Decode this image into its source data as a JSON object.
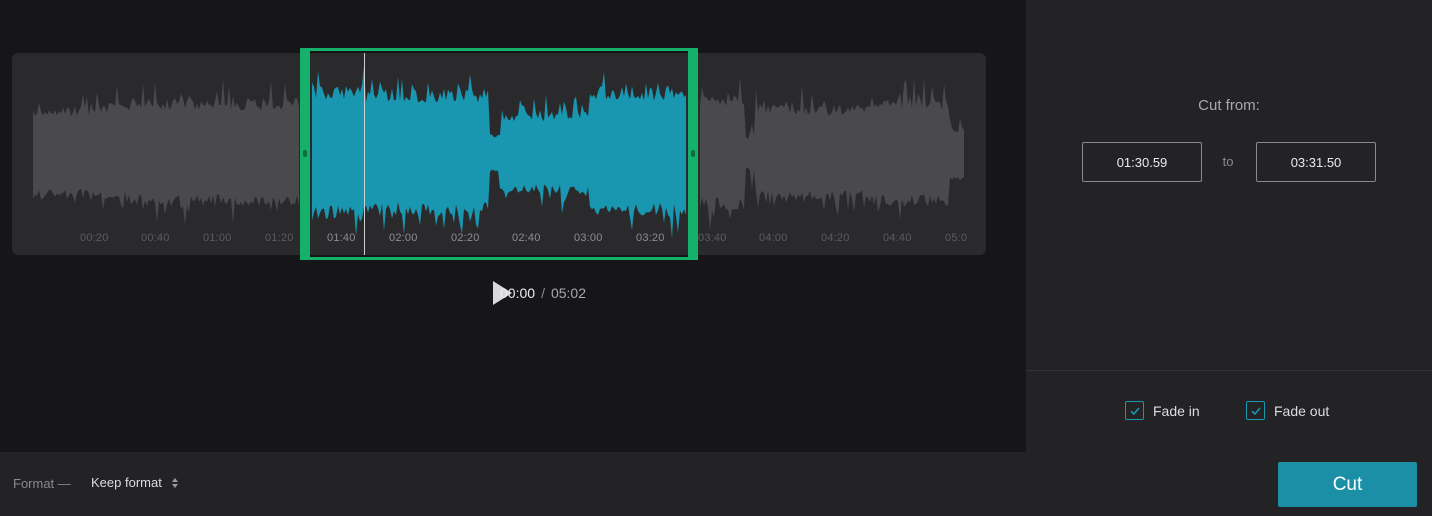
{
  "editor": {
    "ticks": [
      "00:20",
      "00:40",
      "01:00",
      "01:20",
      "01:40",
      "02:00",
      "02:20",
      "02:40",
      "03:00",
      "03:20",
      "03:40",
      "04:00",
      "04:20",
      "04:40",
      "05:0"
    ],
    "play_icon": "play-icon",
    "time": {
      "current": "00:00",
      "separator": "/",
      "total": "05:02"
    },
    "colors": {
      "selected_wave": "#1a97b0",
      "unselected_wave": "#4a4a4c",
      "selection_frame": "#15b06a"
    }
  },
  "panel": {
    "cut_from_label": "Cut from:",
    "start_value": "01:30.59",
    "to_label": "to",
    "end_value": "03:31.50",
    "fade_in": {
      "label": "Fade in",
      "checked": true
    },
    "fade_out": {
      "label": "Fade out",
      "checked": true
    },
    "checkbox_icon": "checkmark-icon"
  },
  "footer": {
    "format_label": "Format —",
    "format_value": "Keep format",
    "format_icon": "sort-arrows-icon",
    "cut_label": "Cut",
    "accent": "#1a8fa6"
  }
}
